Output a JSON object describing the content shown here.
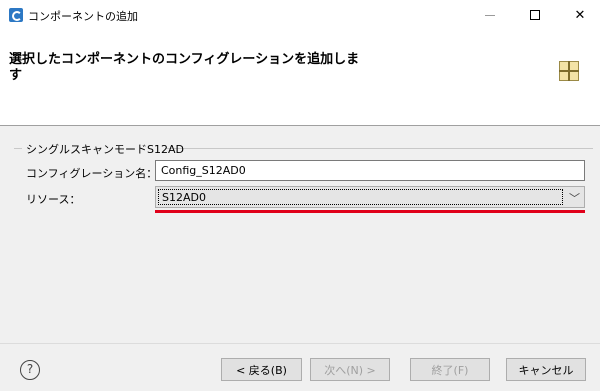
{
  "window": {
    "title": "コンポーネントの追加",
    "minimize": "—",
    "close": "✕"
  },
  "header": {
    "title": "選択したコンポーネントのコンフィグレーションを追加します"
  },
  "group": {
    "title": "シングルスキャンモードS12AD",
    "config_label": "コンフィグレーション名：",
    "config_value": "Config_S12AD0",
    "resource_label": "リソース：",
    "resource_value": "S12AD0",
    "dropdown_arrow": "﹀"
  },
  "footer": {
    "help": "?",
    "back": "< 戻る(B)",
    "next": "次へ(N) >",
    "finish": "終了(F)",
    "cancel": "キャンセル"
  }
}
